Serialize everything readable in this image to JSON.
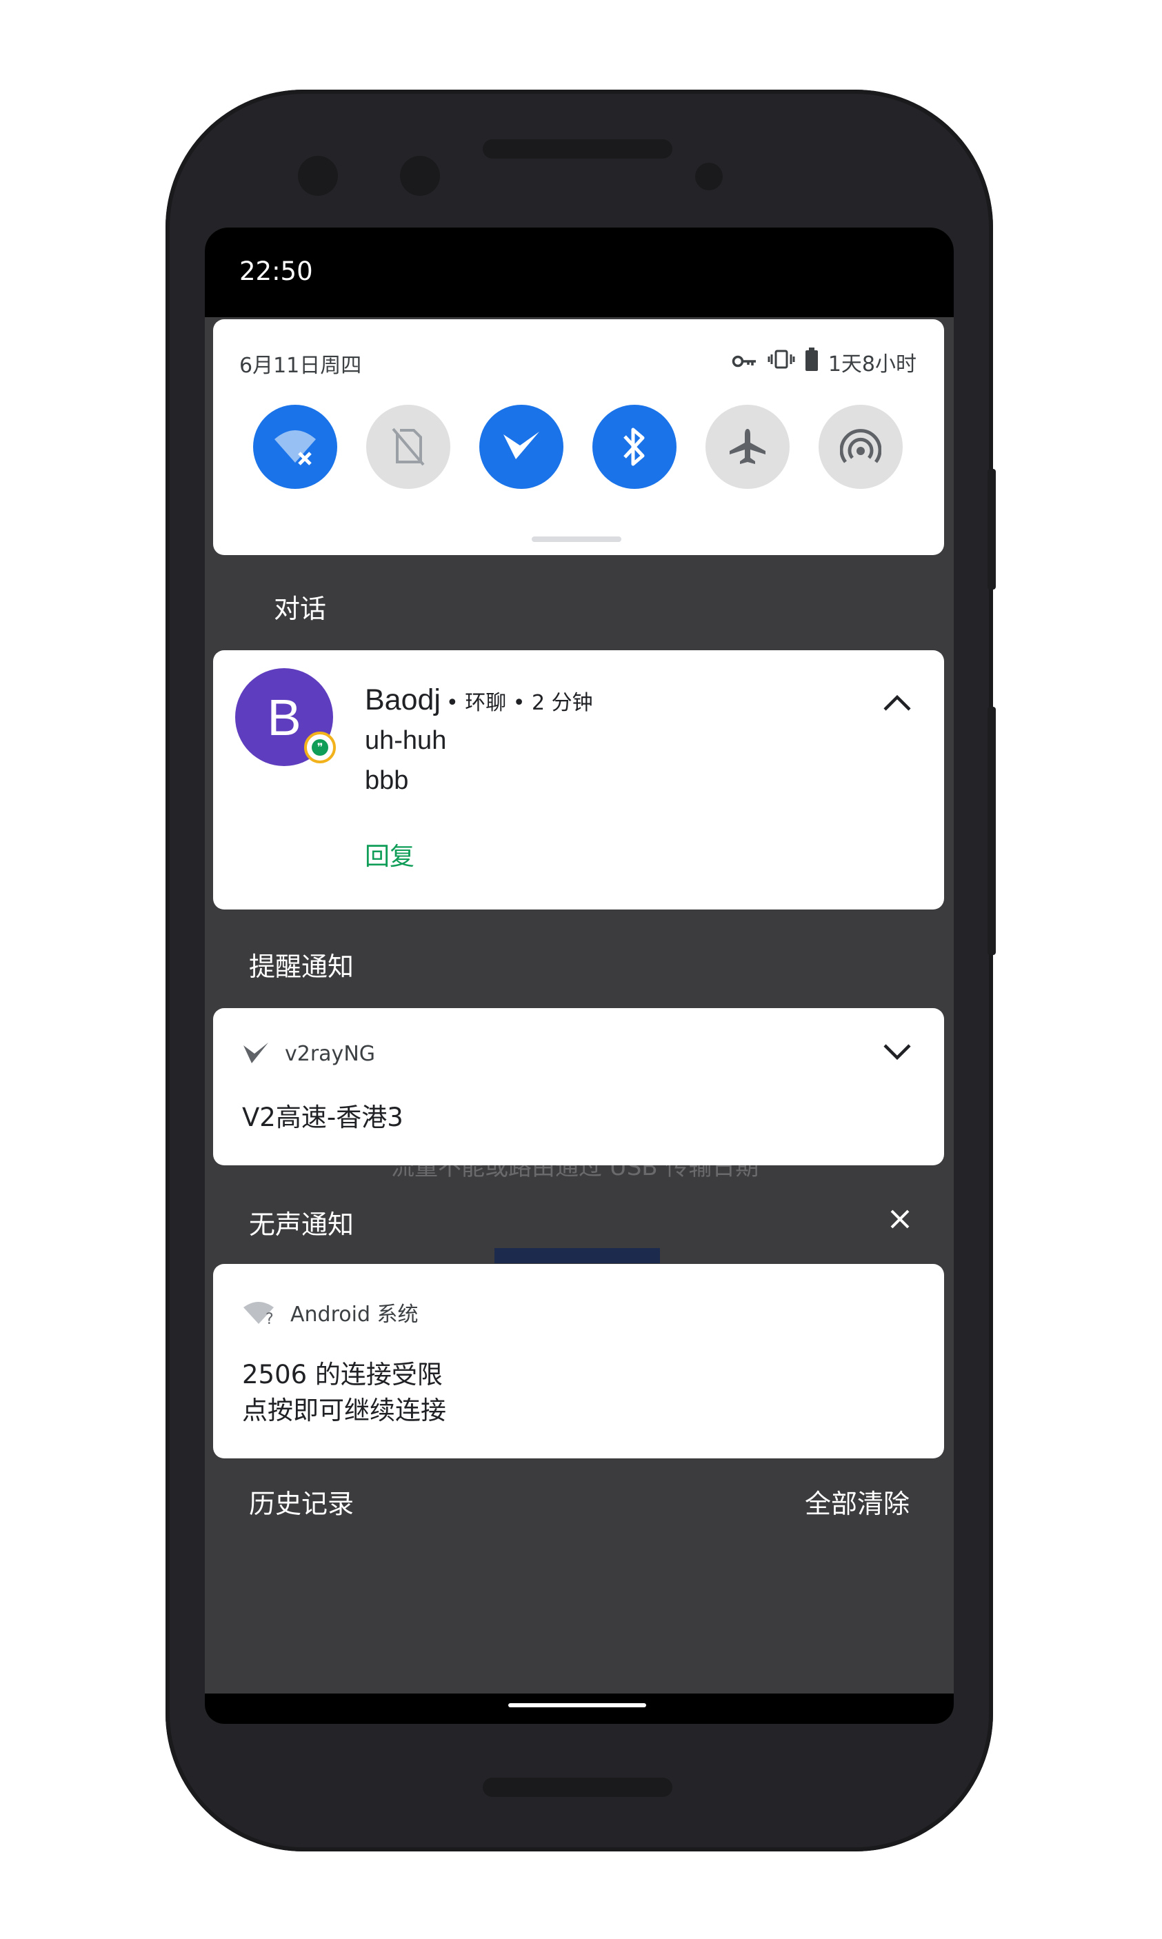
{
  "status_bar": {
    "time": "22:50"
  },
  "quick_settings": {
    "date": "6月11日周四",
    "battery_text": "1天8小时",
    "tiles": [
      {
        "name": "wifi",
        "state": "on"
      },
      {
        "name": "mobile-data",
        "state": "off"
      },
      {
        "name": "v2rayng",
        "state": "on"
      },
      {
        "name": "bluetooth",
        "state": "on"
      },
      {
        "name": "airplane-mode",
        "state": "off"
      },
      {
        "name": "hotspot",
        "state": "off"
      }
    ]
  },
  "sections": {
    "conversations": "对话",
    "alerting": "提醒通知",
    "silent": "无声通知"
  },
  "conversation_card": {
    "avatar_letter": "B",
    "name": "Baodj",
    "meta": "• 环聊 • 2 分钟",
    "messages": [
      "uh-huh",
      "bbb"
    ],
    "reply_label": "回复"
  },
  "v2ray_card": {
    "app_name": "v2rayNG",
    "text": "V2高速-香港3"
  },
  "behind_text": "流量不能或路由通过 USB 传输日期",
  "android_card": {
    "app_name": "Android 系统",
    "line1": "2506 的连接受限",
    "line2": "点按即可继续连接"
  },
  "footer": {
    "history": "历史记录",
    "clear_all": "全部清除"
  },
  "colors": {
    "tile_on": "#1a73e8",
    "tile_off": "#e0e0e0",
    "shade_bg": "#3c3c3e",
    "avatar": "#5f3dbf",
    "reply": "#0f9d58"
  }
}
